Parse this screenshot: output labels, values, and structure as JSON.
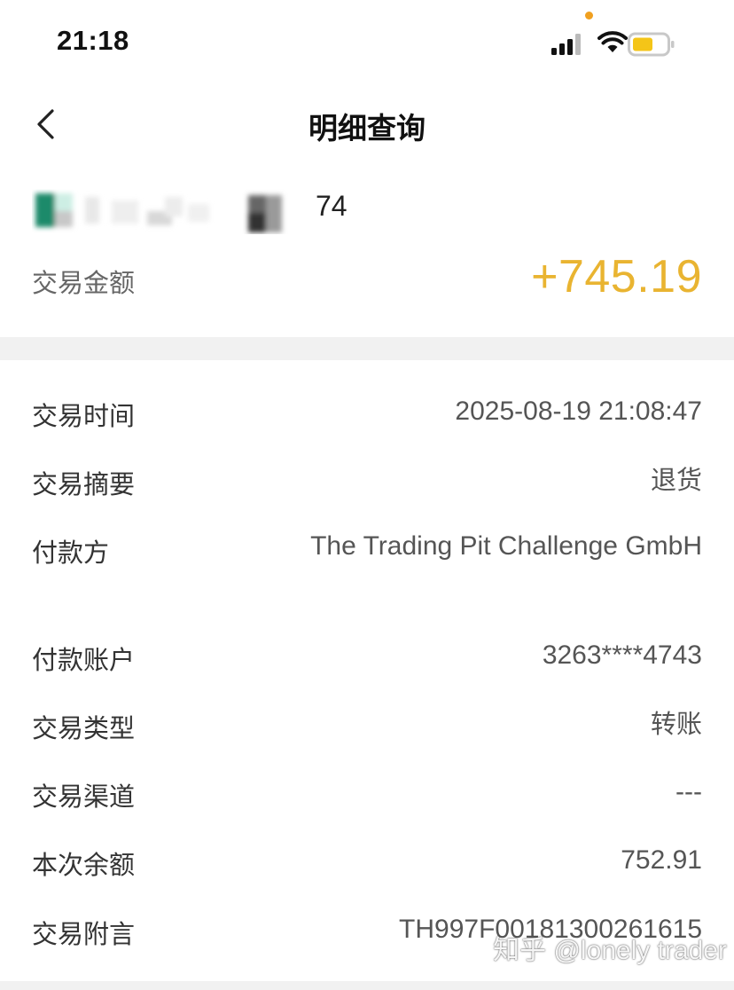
{
  "status_bar": {
    "time": "21:18"
  },
  "nav": {
    "title": "明细查询"
  },
  "account": {
    "suffix": "74"
  },
  "amount": {
    "label": "交易金额",
    "value": "+745.19",
    "color": "#e9b431"
  },
  "details": [
    {
      "label": "交易时间",
      "value": "2025-08-19 21:08:47"
    },
    {
      "label": "交易摘要",
      "value": "退货"
    },
    {
      "label": "付款方",
      "value": "The Trading Pit Challenge GmbH"
    },
    {
      "label": "付款账户",
      "value": "3263****4743"
    },
    {
      "label": "交易类型",
      "value": "转账"
    },
    {
      "label": "交易渠道",
      "value": "---"
    },
    {
      "label": "本次余额",
      "value": "752.91"
    },
    {
      "label": "交易附言",
      "value": "TH997F00181300261615"
    }
  ],
  "watermark": "知乎 @lonely trader",
  "icons": {
    "back": "chevron-left-icon",
    "signal": "signal-icon",
    "wifi": "wifi-icon",
    "battery": "battery-icon"
  }
}
